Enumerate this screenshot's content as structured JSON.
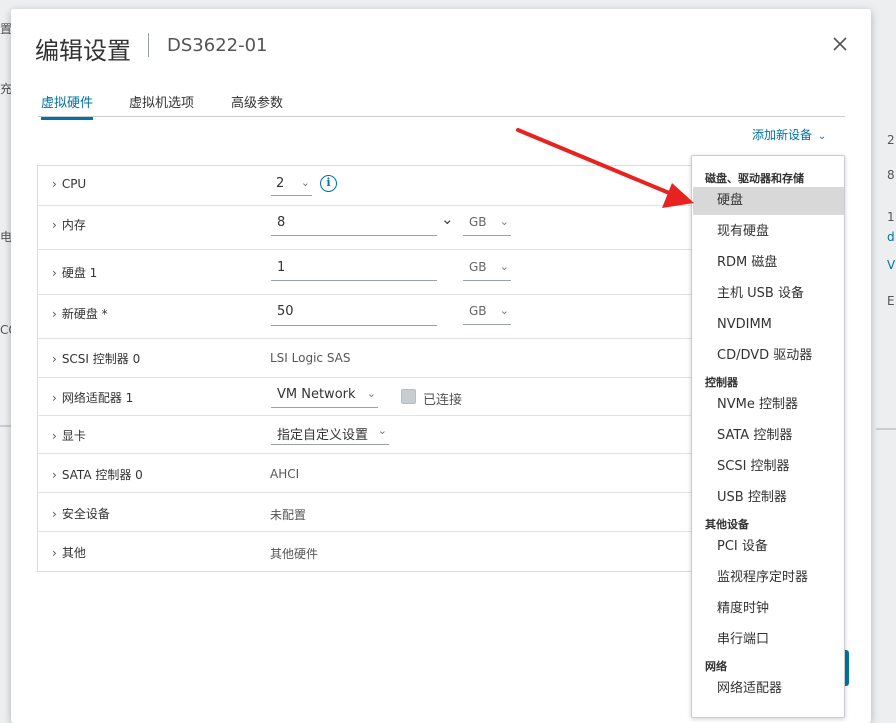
{
  "background": {
    "fragments": [
      "置",
      "充",
      "电",
      "CO",
      "2",
      "8",
      "1",
      "d",
      "V",
      "E"
    ]
  },
  "dialog": {
    "title": "编辑设置",
    "subtitle": "DS3622-01",
    "tabs": [
      "虚拟硬件",
      "虚拟机选项",
      "高级参数"
    ],
    "add_device": "添加新设备"
  },
  "hardware": {
    "cpu": {
      "label": "CPU",
      "value": "2"
    },
    "memory": {
      "label": "内存",
      "value": "8",
      "unit": "GB"
    },
    "disk1": {
      "label": "硬盘 1",
      "value": "1",
      "unit": "GB"
    },
    "new_disk": {
      "label": "新硬盘 *",
      "value": "50",
      "unit": "GB"
    },
    "scsi": {
      "label": "SCSI 控制器 0",
      "value": "LSI Logic SAS"
    },
    "nic": {
      "label": "网络适配器 1",
      "value": "VM Network",
      "connected_label": "已连接"
    },
    "video": {
      "label": "显卡",
      "value": "指定自定义设置"
    },
    "sata": {
      "label": "SATA 控制器 0",
      "value": "AHCI"
    },
    "security": {
      "label": "安全设备",
      "value": "未配置"
    },
    "other": {
      "label": "其他",
      "value": "其他硬件"
    }
  },
  "menu": {
    "sections": [
      {
        "header": "磁盘、驱动器和存储",
        "items": [
          "硬盘",
          "现有硬盘",
          "RDM 磁盘",
          "主机 USB 设备",
          "NVDIMM",
          "CD/DVD 驱动器"
        ]
      },
      {
        "header": "控制器",
        "items": [
          "NVMe 控制器",
          "SATA 控制器",
          "SCSI 控制器",
          "USB 控制器"
        ]
      },
      {
        "header": "其他设备",
        "items": [
          "PCI 设备",
          "监视程序定时器",
          "精度时钟",
          "串行端口"
        ]
      },
      {
        "header": "网络",
        "items": [
          "网络适配器"
        ]
      }
    ],
    "highlighted": "硬盘"
  },
  "colors": {
    "accent": "#0072a3",
    "arrow": "#e8231f",
    "highlight": "#d8d8d8"
  }
}
